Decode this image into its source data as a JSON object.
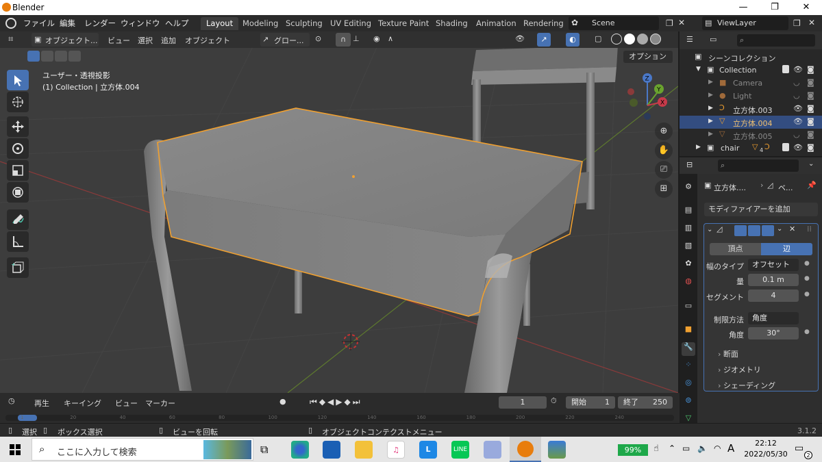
{
  "titlebar": {
    "title": "Blender",
    "minimize": "—",
    "maximize": "❐",
    "close": "✕"
  },
  "topbar": {
    "menus": [
      "ファイル",
      "編集",
      "レンダー",
      "ウィンドウ",
      "ヘルプ"
    ],
    "workspaces": [
      "Layout",
      "Modeling",
      "Sculpting",
      "UV Editing",
      "Texture Paint",
      "Shading",
      "Animation",
      "Rendering"
    ],
    "active_workspace": "Layout",
    "scene": "Scene",
    "view_layer": "ViewLayer"
  },
  "viewport_header": {
    "mode": "オブジェクト...",
    "menus": [
      "ビュー",
      "選択",
      "追加",
      "オブジェクト"
    ],
    "transform_orientation": "グロー...",
    "options_label": "オプション"
  },
  "viewport_overlay": {
    "view_name": "ユーザー・透視投影",
    "context": "(1) Collection | 立方体.004"
  },
  "gizmo": {
    "z": "Z",
    "y": "Y",
    "x": "X"
  },
  "outliner": {
    "search_placeholder": "",
    "rows": [
      {
        "label": "シーンコレクション"
      },
      {
        "label": "Collection"
      },
      {
        "label": "Camera"
      },
      {
        "label": "Light"
      },
      {
        "label": "立方体.003"
      },
      {
        "label": "立方体.004"
      },
      {
        "label": "立方体.005"
      },
      {
        "label": "chair"
      }
    ],
    "chair_badge": "4"
  },
  "properties": {
    "breadcrumb_object": "立方体....",
    "breadcrumb_modifier": "ベ...",
    "add_modifier": "モディファイアーを追加",
    "affect_options": [
      "頂点",
      "辺"
    ],
    "affect_active": "辺",
    "width_type_label": "幅のタイプ",
    "width_type_value": "オフセット",
    "amount_label": "量",
    "amount_value": "0.1 m",
    "segments_label": "セグメント",
    "segments_value": "4",
    "limit_method_label": "制限方法",
    "limit_method_value": "角度",
    "angle_label": "角度",
    "angle_value": "30°",
    "subpanels": [
      "断面",
      "ジオメトリ",
      "シェーディング"
    ]
  },
  "timeline": {
    "menus": [
      "再生",
      "キーイング",
      "ビュー",
      "マーカー"
    ],
    "current_frame": "1",
    "start_label": "開始",
    "start_value": "1",
    "end_label": "終了",
    "end_value": "250",
    "ruler_ticks": [
      "1",
      "20",
      "40",
      "60",
      "80",
      "100",
      "120",
      "140",
      "160",
      "180",
      "200",
      "220",
      "240"
    ]
  },
  "statusbar": {
    "select": "選択",
    "box_select": "ボックス選択",
    "rotate_view": "ビューを回転",
    "context_menu": "オブジェクトコンテクストメニュー",
    "version": "3.1.2"
  },
  "taskbar": {
    "search_placeholder": "ここに入力して検索",
    "battery": "99%",
    "ime": "A",
    "time": "22:12",
    "date": "2022/05/30",
    "notifications": "2"
  },
  "colors": {
    "accent_blue": "#4772b3",
    "selection_orange": "#f0a030",
    "viewport_bg": "#3d3d3d",
    "panel_bg": "#2e2e2e"
  }
}
